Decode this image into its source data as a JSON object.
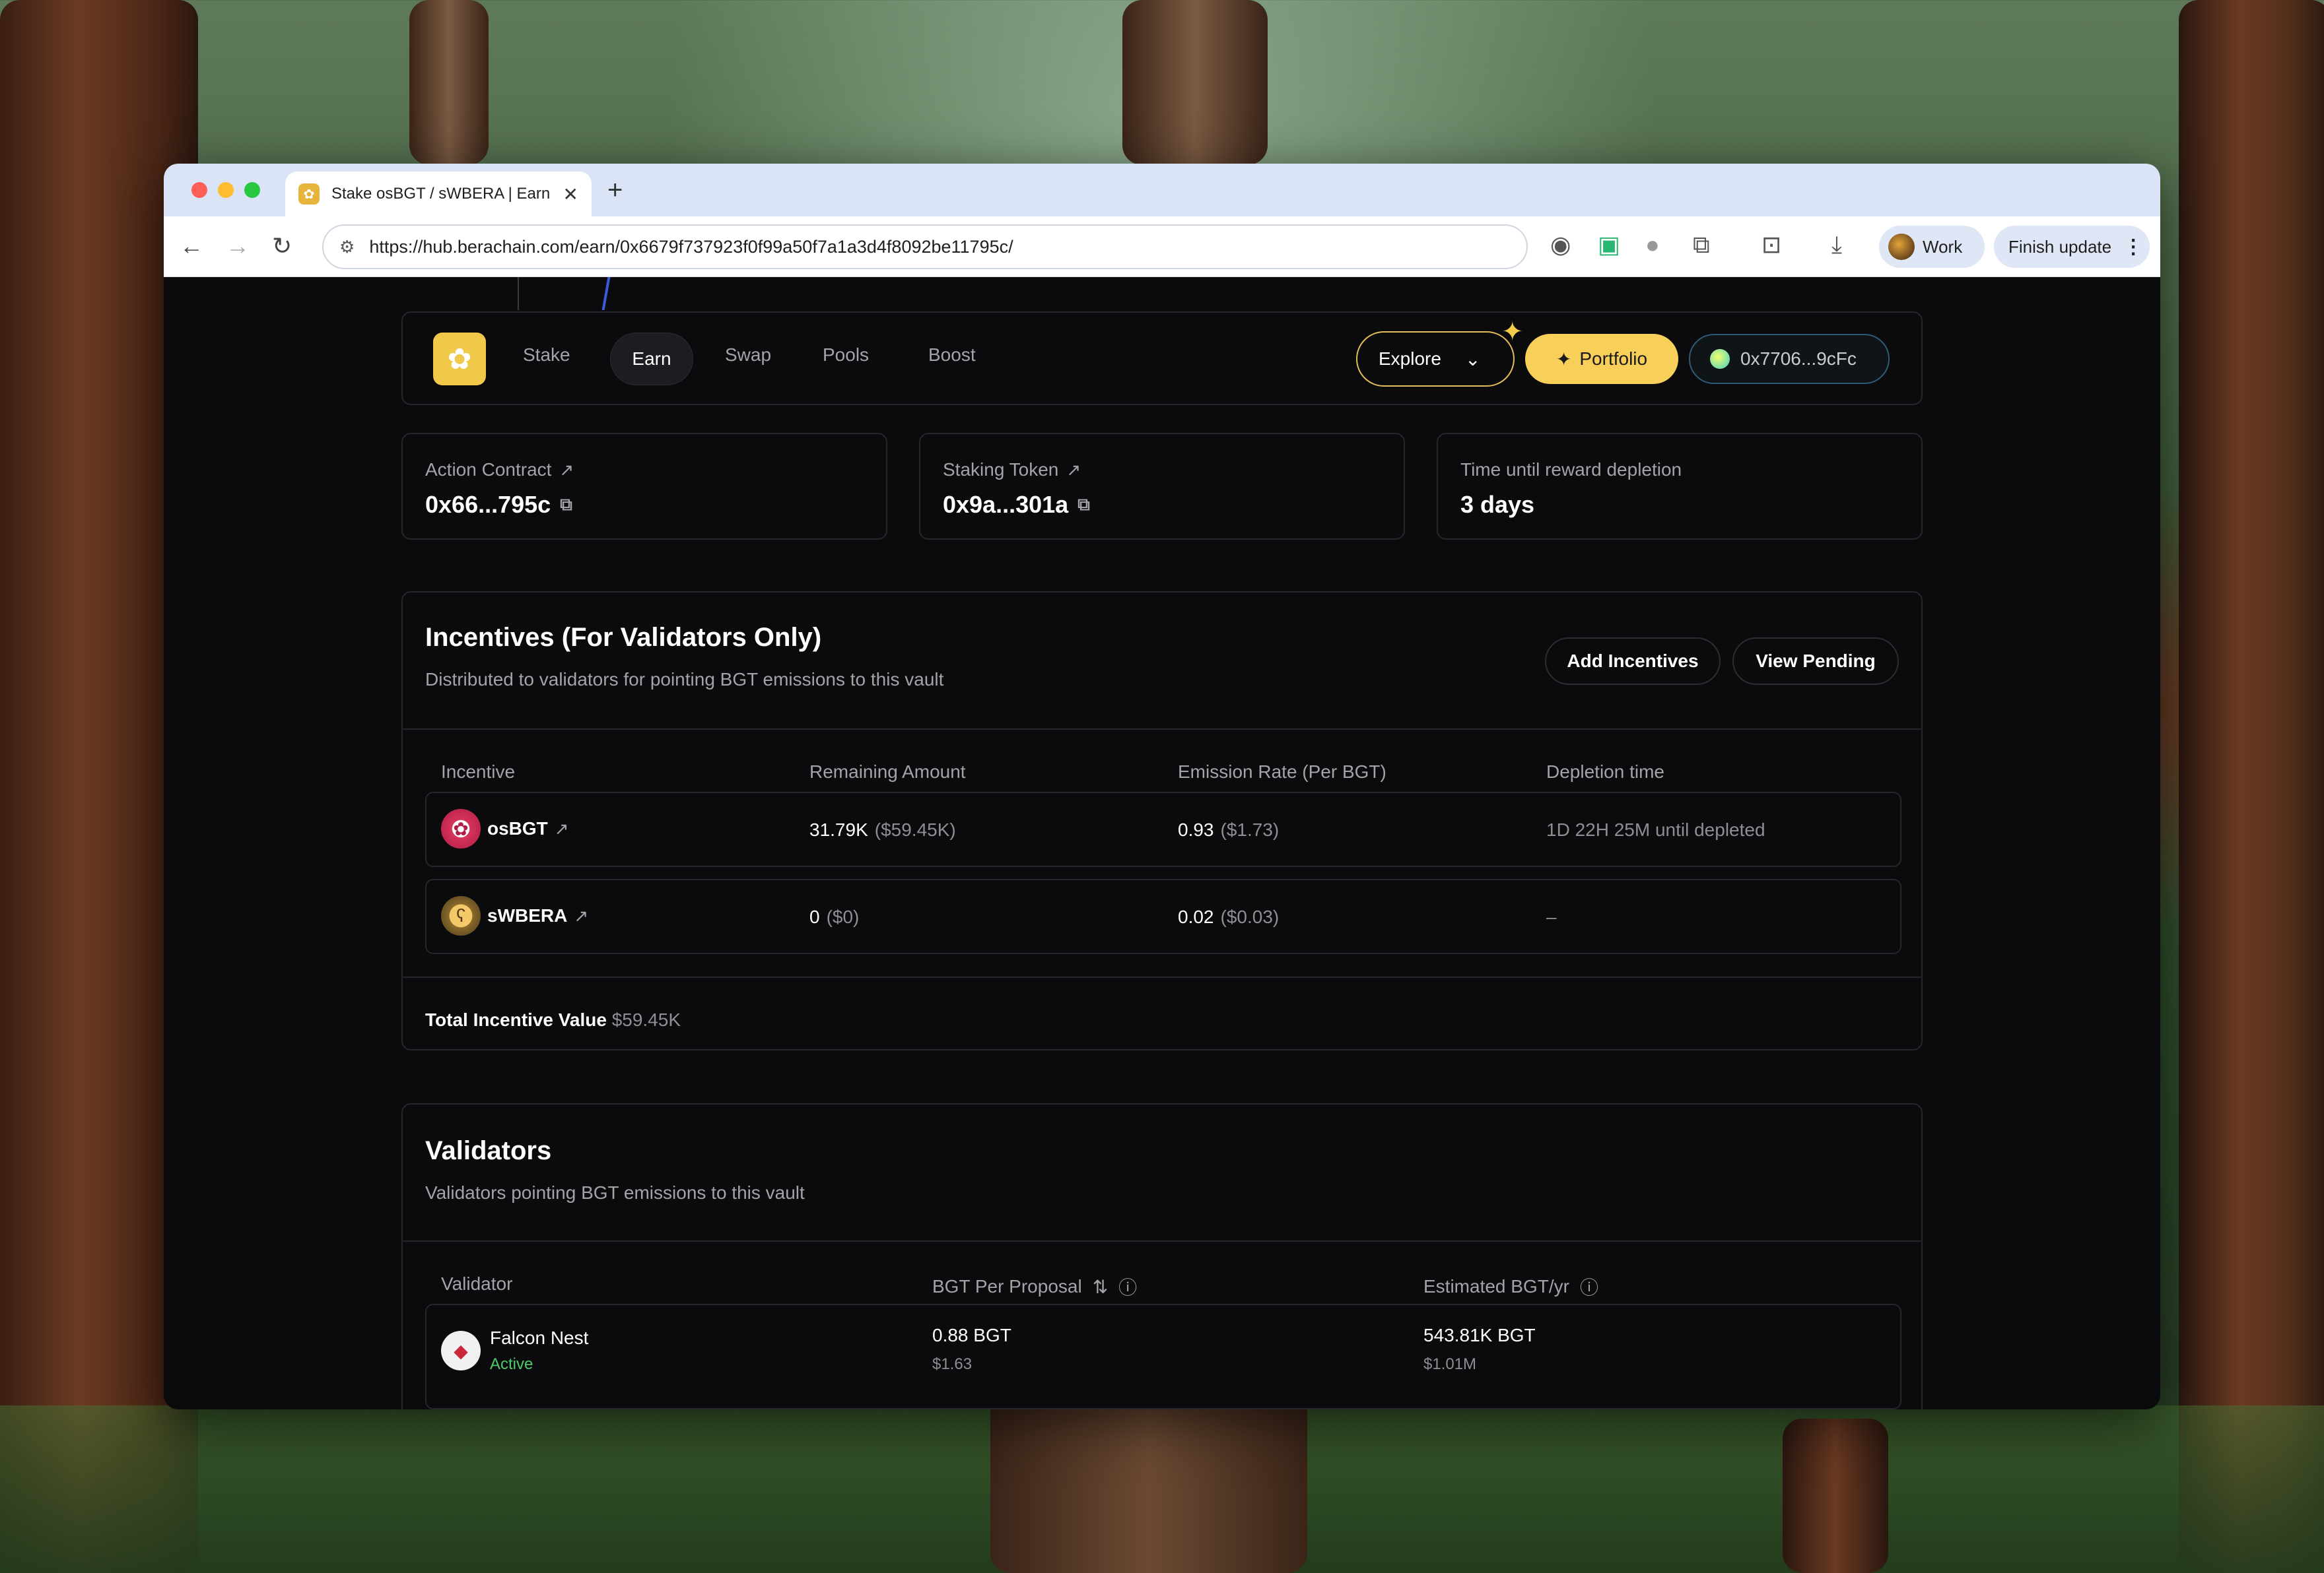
{
  "browser": {
    "tab_title": "Stake osBGT / sWBERA | Earn",
    "url": "https://hub.berachain.com/earn/0x6679f737923f0f99a50f7a1a3d4f8092be11795c/",
    "profile_label": "Work",
    "update_label": "Finish update"
  },
  "nav": {
    "links": [
      "Stake",
      "Earn",
      "Swap",
      "Pools",
      "Boost"
    ],
    "active_link": "Earn",
    "explore_label": "Explore",
    "portfolio_label": "Portfolio",
    "wallet_label": "0x7706...9cFc"
  },
  "stats": [
    {
      "label": "Action Contract",
      "value": "0x66...795c"
    },
    {
      "label": "Staking Token",
      "value": "0x9a...301a"
    },
    {
      "label": "Time until reward depletion",
      "value": "3 days"
    }
  ],
  "incentives": {
    "title": "Incentives (For Validators Only)",
    "subtitle": "Distributed to validators for pointing BGT emissions to this vault",
    "add_label": "Add Incentives",
    "pending_label": "View Pending",
    "columns": [
      "Incentive",
      "Remaining Amount",
      "Emission Rate (Per BGT)",
      "Depletion time"
    ],
    "rows": [
      {
        "token": "osBGT",
        "remaining": "31.79K",
        "remaining_usd": "($59.45K)",
        "rate": "0.93",
        "rate_usd": "($1.73)",
        "depletion": "1D 22H 25M until depleted"
      },
      {
        "token": "sWBERA",
        "remaining": "0",
        "remaining_usd": "($0)",
        "rate": "0.02",
        "rate_usd": "($0.03)",
        "depletion": "–"
      }
    ],
    "total_label": "Total Incentive Value",
    "total_value": "$59.45K"
  },
  "validators": {
    "title": "Validators",
    "subtitle": "Validators pointing BGT emissions to this vault",
    "columns": [
      "Validator",
      "BGT Per Proposal",
      "Estimated BGT/yr"
    ],
    "rows": [
      {
        "name": "Falcon Nest",
        "status": "Active",
        "per_proposal": "0.88 BGT",
        "per_proposal_usd": "$1.63",
        "per_year": "543.81K BGT",
        "per_year_usd": "$1.01M"
      }
    ]
  }
}
